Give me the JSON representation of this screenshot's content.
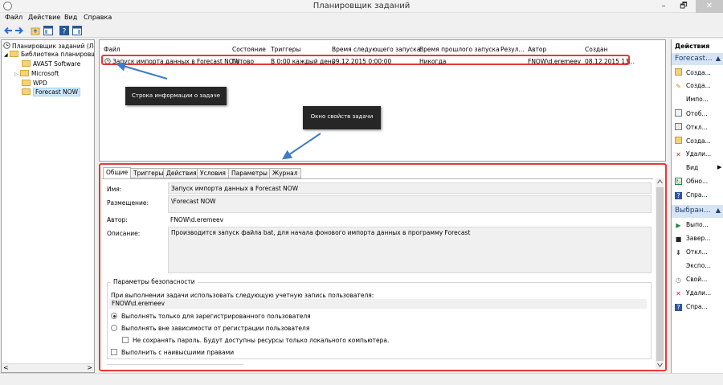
{
  "window": {
    "title": "Планировщик заданий",
    "min": "–",
    "max": "🗗",
    "close": "✕"
  },
  "menu": [
    "Файл",
    "Действие",
    "Вид",
    "Справка"
  ],
  "tree": {
    "root": "Планировщик заданий (Лок",
    "library": "Библиотека планировщ",
    "children": [
      "AVAST Software",
      "Microsoft",
      "WPD",
      "Forecast NOW"
    ],
    "scroll_left": "<",
    "scroll_right": ">"
  },
  "tasklist": {
    "columns": [
      "Файл",
      "Состояние",
      "Триггеры",
      "Время следующего запуска",
      "Время прошлого запуска",
      "Резул...",
      "Автор",
      "Создан"
    ],
    "row": {
      "name": "Запуск импорта данных в Forecast NOW",
      "status": "Готово",
      "trigger": "В 0:00 каждый день",
      "next_run": "09.12.2015 0:00:00",
      "last_run": "Никогда",
      "result": "",
      "author": "FNOW\\d.eremeev",
      "created": "08.12.2015 13..."
    }
  },
  "callouts": {
    "row_info": "Строка информации о задаче",
    "props_window": "Окно свойств задачи"
  },
  "props": {
    "tabs": [
      "Общие",
      "Триггеры",
      "Действия",
      "Условия",
      "Параметры",
      "Журнал"
    ],
    "name_label": "Имя:",
    "name_value": "Запуск импорта данных в Forecast NOW",
    "location_label": "Размещение:",
    "location_value": "\\Forecast NOW",
    "author_label": "Автор:",
    "author_value": "FNOW\\d.eremeev",
    "desc_label": "Описание:",
    "desc_value": "Производится запуск файла bat, для начала фонового импорта данных в программу Forecast",
    "security_title": "Параметры безопасности",
    "account_prompt": "При выполнении задачи использовать следующую учетную запись пользователя:",
    "account_value": "FNOW\\d.eremeev",
    "opt_logged_on": "Выполнять только для зарегистрированного пользователя",
    "opt_any": "Выполнять вне зависимости от регистрации пользователя",
    "opt_no_password": "Не сохранять пароль. Будут доступны ресурсы только локального компьютера.",
    "opt_highest": "Выполнить с наивысшими правами"
  },
  "actions": {
    "header": "Действия",
    "group1": "Forecast...",
    "group1_items": [
      "Созда...",
      "Созда...",
      "Импо...",
      "Отоб...",
      "Откл...",
      "Созда...",
      "Удали...",
      "Вид",
      "Обно...",
      "Спра..."
    ],
    "group2": "Выбран...",
    "group2_items": [
      "Выпо...",
      "Завер...",
      "Откл...",
      "Экспо...",
      "Свой...",
      "Удали...",
      "Спра..."
    ]
  }
}
